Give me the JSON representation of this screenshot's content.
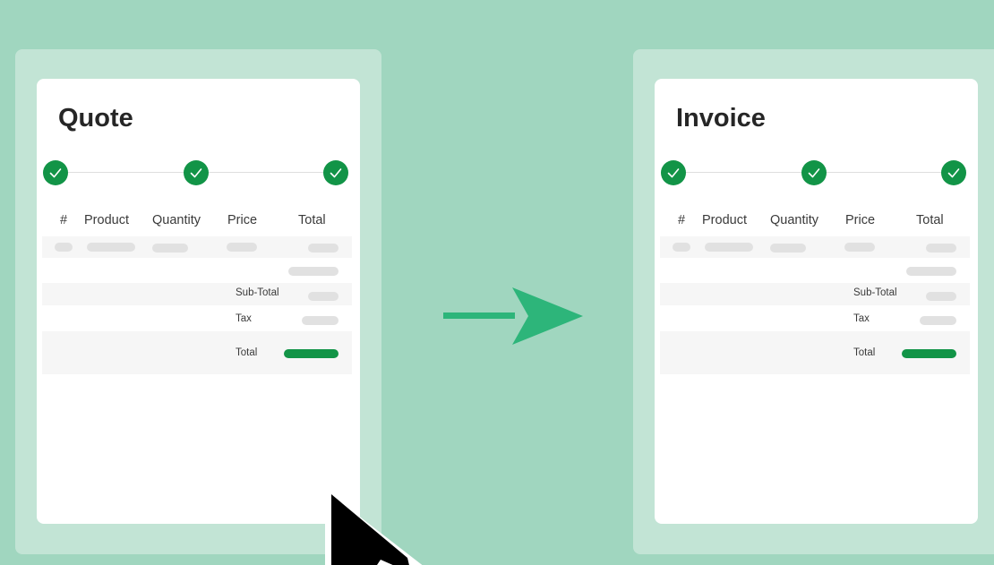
{
  "colors": {
    "background": "#a0d6bf",
    "panel": "#c2e4d5",
    "accent_green": "#129447",
    "arrow_green": "#2db57a"
  },
  "quote": {
    "title": "Quote",
    "columns": [
      "#",
      "Product",
      "Quantity",
      "Price",
      "Total"
    ],
    "summary": {
      "subtotal_label": "Sub-Total",
      "tax_label": "Tax",
      "total_label": "Total"
    },
    "steps_completed": 3
  },
  "invoice": {
    "title": "Invoice",
    "columns": [
      "#",
      "Product",
      "Quantity",
      "Price",
      "Total"
    ],
    "summary": {
      "subtotal_label": "Sub-Total",
      "tax_label": "Tax",
      "total_label": "Total"
    },
    "steps_completed": 3
  },
  "icons": {
    "step": "check-circle-icon",
    "transition": "arrow-right-icon",
    "pointer": "mouse-cursor-icon"
  }
}
